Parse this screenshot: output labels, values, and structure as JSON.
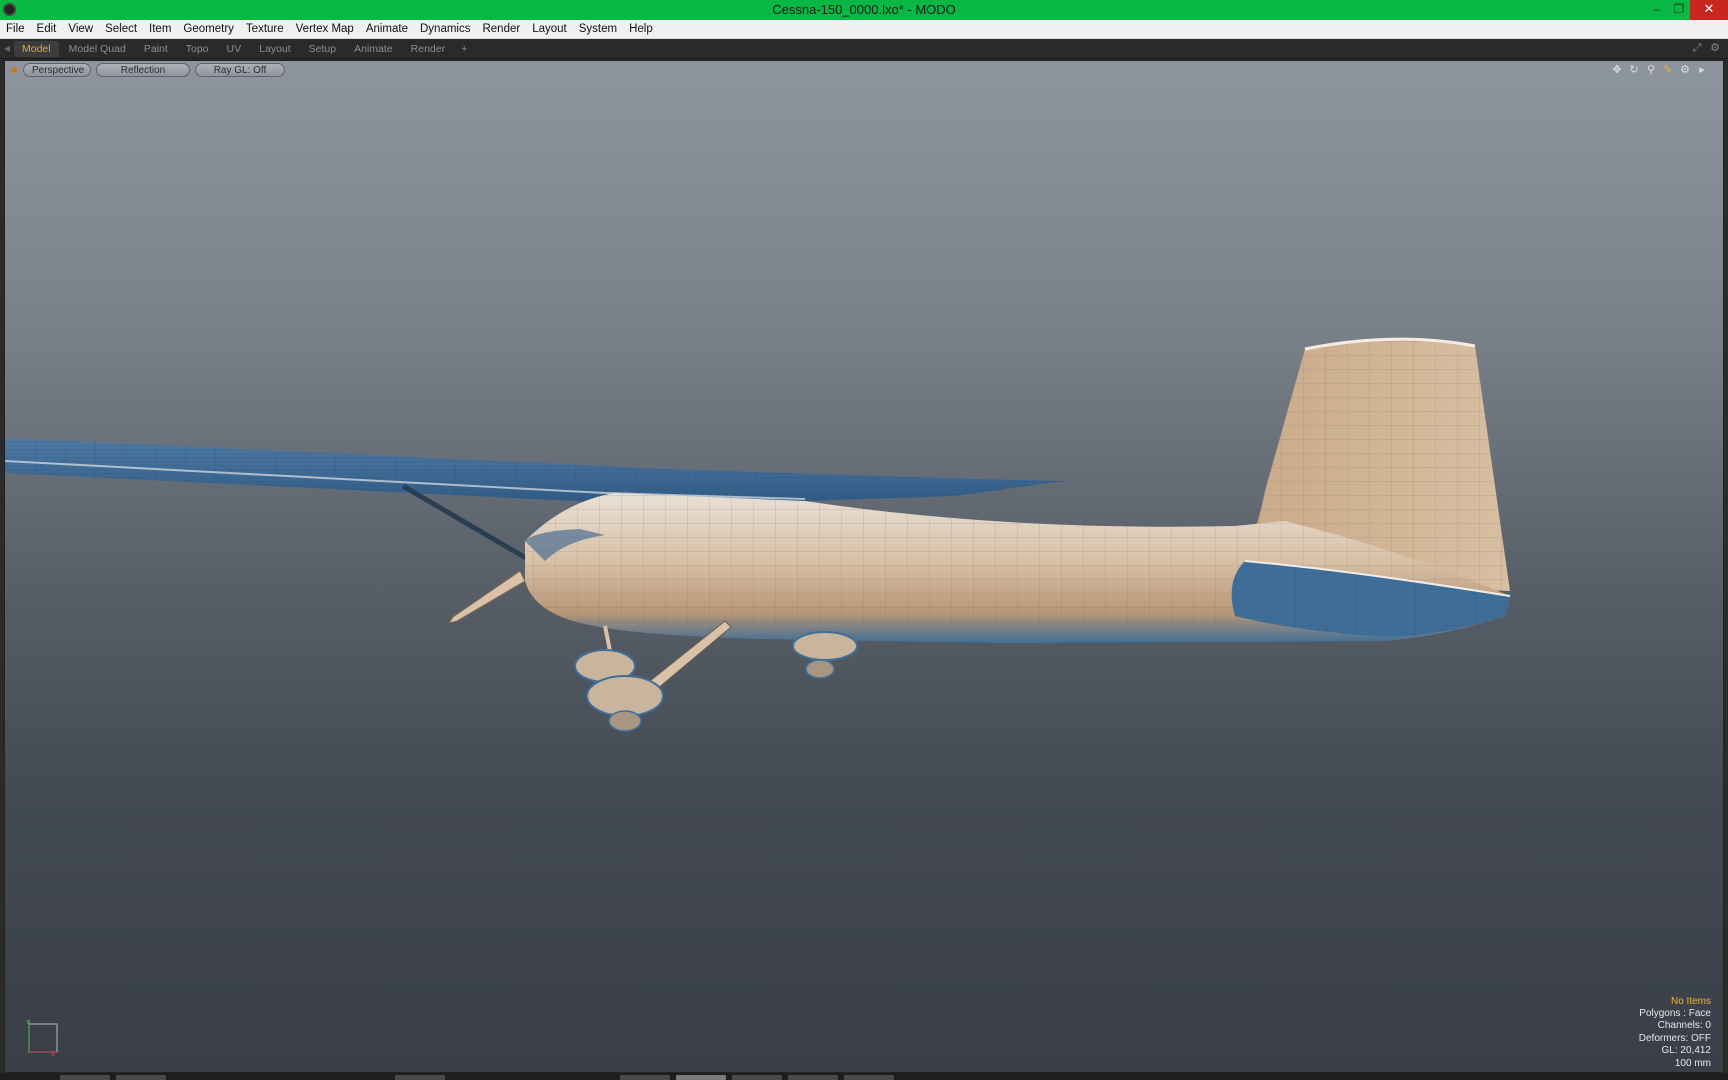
{
  "window": {
    "title": "Cessna-150_0000.lxo* - MODO",
    "minimize": "–",
    "restore": "❐",
    "close": "✕"
  },
  "menu": [
    "File",
    "Edit",
    "View",
    "Select",
    "Item",
    "Geometry",
    "Texture",
    "Vertex Map",
    "Animate",
    "Dynamics",
    "Render",
    "Layout",
    "System",
    "Help"
  ],
  "layout_tabs": {
    "items": [
      "Model",
      "Model Quad",
      "Paint",
      "Topo",
      "UV",
      "Layout",
      "Setup",
      "Animate",
      "Render"
    ],
    "active": "Model",
    "add_label": "+"
  },
  "viewport": {
    "view_mode": "Perspective",
    "shading": "Reflection",
    "ray_gl": "Ray GL: Off",
    "icons": [
      "move-view-icon",
      "rotate-view-icon",
      "zoom-view-icon",
      "pen-icon",
      "gear-icon",
      "arrow-right-icon"
    ],
    "axis": {
      "y": "Y",
      "x": "X"
    }
  },
  "status": {
    "selection": "No Items",
    "polygons": "Polygons : Face",
    "channels": "Channels: 0",
    "deformers": "Deformers: OFF",
    "gl": "GL: 20,412",
    "grid": "100 mm"
  },
  "colors": {
    "title_bar": "#09b844",
    "active_tab": "#e9a33a",
    "mesh_fill": "#d9c0a4",
    "mesh_shadow": "#3f6f99",
    "status_highlight": "#f0b43c"
  }
}
